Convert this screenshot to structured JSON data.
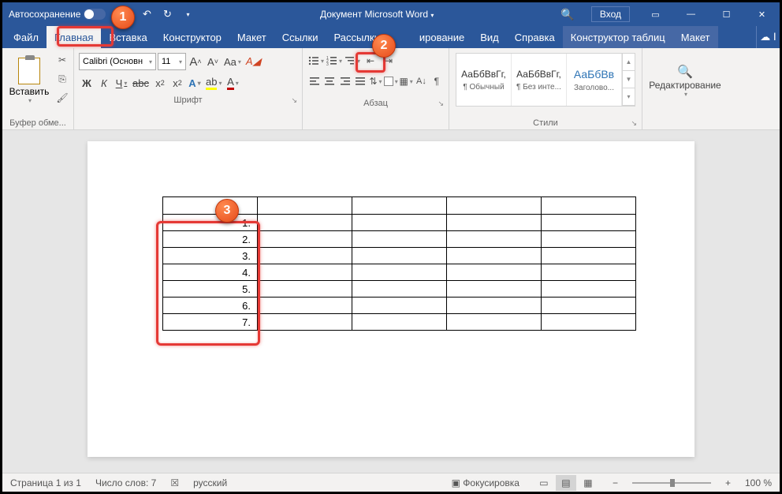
{
  "title_bar": {
    "autosave": "Автосохранение",
    "doc_title": "Документ Microsoft Word",
    "login": "Вход"
  },
  "tabs": {
    "file": "Файл",
    "home": "Главная",
    "insert": "Вставка",
    "design": "Конструктор",
    "layout": "Макет",
    "references": "Ссылки",
    "mailings": "Рассылки",
    "review_partial": "ирование",
    "view": "Вид",
    "help": "Справка",
    "table_design": "Конструктор таблиц",
    "table_layout": "Макет"
  },
  "ribbon": {
    "clipboard": {
      "paste": "Вставить",
      "label": "Буфер обме..."
    },
    "font": {
      "name": "Calibri (Основн",
      "size": "11",
      "label": "Шрифт",
      "bold": "Ж",
      "italic": "К",
      "underline": "Ч",
      "strike": "abc",
      "sub": "x",
      "sup": "x",
      "bigA": "A",
      "smallA": "A",
      "caseAa": "Aa",
      "clear": "A"
    },
    "para": {
      "label": "Абзац"
    },
    "styles": {
      "label": "Стили",
      "items": [
        {
          "preview": "АаБбВвГг,",
          "name": "¶ Обычный"
        },
        {
          "preview": "АаБбВвГг,",
          "name": "¶ Без инте..."
        },
        {
          "preview": "АаБбВв",
          "name": "Заголово..."
        }
      ]
    },
    "editing": {
      "label": "Редактирование"
    }
  },
  "table": {
    "rows": [
      "1.",
      "2.",
      "3.",
      "4.",
      "5.",
      "6.",
      "7."
    ]
  },
  "status": {
    "page": "Страница 1 из 1",
    "words": "Число слов: 7",
    "lang": "русский",
    "focus": "Фокусировка",
    "zoom": "100 %"
  },
  "callouts": {
    "c1": "1",
    "c2": "2",
    "c3": "3"
  }
}
